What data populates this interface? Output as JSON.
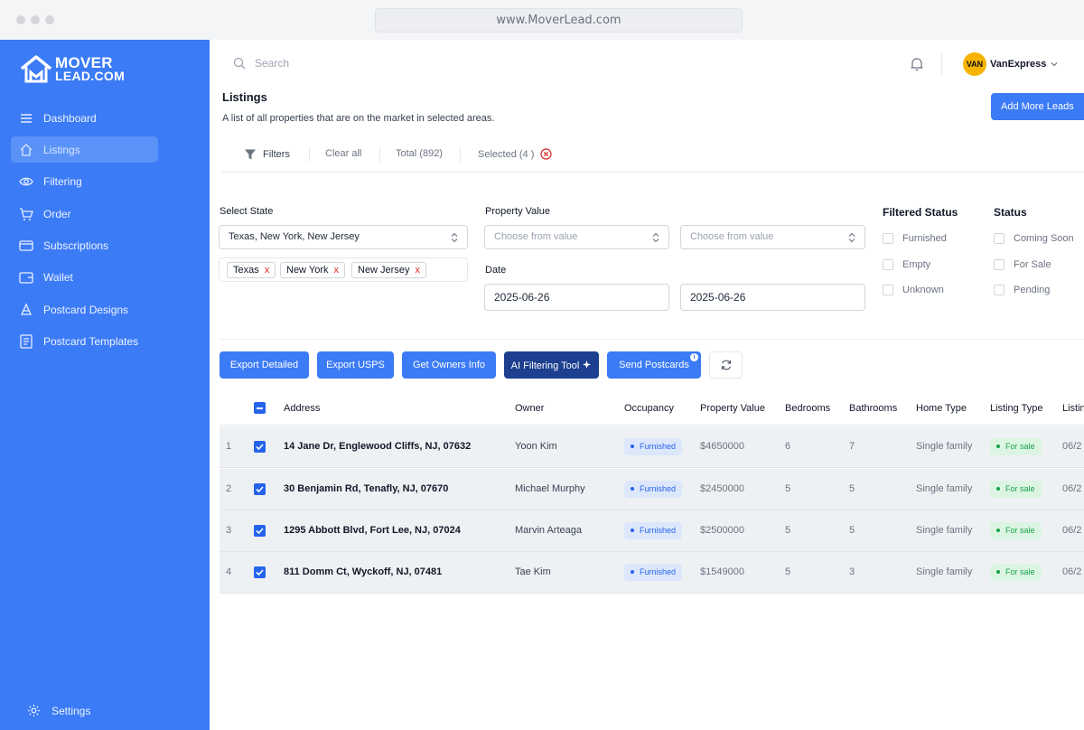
{
  "browser": {
    "url": "www.MoverLead.com"
  },
  "brand": {
    "line1": "MOVER",
    "line2": "LEAD.COM"
  },
  "sidebar": {
    "items": [
      {
        "label": "Dashboard",
        "icon": "menu-icon"
      },
      {
        "label": "Listings",
        "icon": "home-icon",
        "active": true
      },
      {
        "label": "Filtering",
        "icon": "eye-icon"
      },
      {
        "label": "Order",
        "icon": "cart-icon"
      },
      {
        "label": "Subscriptions",
        "icon": "card-icon"
      },
      {
        "label": "Wallet",
        "icon": "wallet-icon"
      },
      {
        "label": "Postcard Designs",
        "icon": "palette-icon"
      },
      {
        "label": "Postcard Templates",
        "icon": "template-icon"
      }
    ],
    "settings_label": "Settings"
  },
  "topbar": {
    "search_placeholder": "Search",
    "avatar_text": "VAN",
    "user_name": "VanExpress"
  },
  "page": {
    "title": "Listings",
    "subtitle": "A list of all properties that are on the market in selected areas.",
    "add_button": "Add More Leads"
  },
  "filterbar": {
    "filters": "Filters",
    "clear_all": "Clear all",
    "total": "Total (892)",
    "selected": "Selected (4 )"
  },
  "filters": {
    "state_label": "Select State",
    "state_value": "Texas, New York, New Jersey",
    "state_chips": [
      "Texas",
      "New York",
      "New Jersey"
    ],
    "chip_remove": "x",
    "value_label": "Property Value",
    "value_from_placeholder": "Choose from value",
    "value_to_placeholder": "Choose from value",
    "date_label": "Date",
    "date_from": "2025-06-26",
    "date_to": "2025-06-26",
    "filtered_status_label": "Filtered Status",
    "filtered_status_options": [
      "Furnished",
      "Empty",
      "Unknown"
    ],
    "status_label": "Status",
    "status_options": [
      "Coming Soon",
      "For Sale",
      "Pending"
    ]
  },
  "actions": {
    "export_detailed": "Export Detailed",
    "export_usps": "Export USPS",
    "get_owners": "Get Owners Info",
    "ai_tool": "AI Filtering Tool",
    "send_postcards": "Send Postcards",
    "send_badge": "i"
  },
  "table": {
    "columns": [
      "Address",
      "Owner",
      "Occupancy",
      "Property Value",
      "Bedrooms",
      "Bathrooms",
      "Home Type",
      "Listing Type",
      "Listin"
    ],
    "rows": [
      {
        "num": "1",
        "address": "14 Jane Dr, Englewood Cliffs, NJ, 07632",
        "owner": "Yoon Kim",
        "occupancy": "Furnished",
        "value": "$4650000",
        "bedrooms": "6",
        "bathrooms": "7",
        "home_type": "Single family",
        "listing_type": "For sale",
        "date": "06/2"
      },
      {
        "num": "2",
        "address": "30 Benjamin Rd, Tenafly, NJ, 07670",
        "owner": "Michael Murphy",
        "occupancy": "Furnished",
        "value": "$2450000",
        "bedrooms": "5",
        "bathrooms": "5",
        "home_type": "Single family",
        "listing_type": "For sale",
        "date": "06/2"
      },
      {
        "num": "3",
        "address": "1295 Abbott Blvd, Fort Lee, NJ, 07024",
        "owner": "Marvin Arteaga",
        "occupancy": "Furnished",
        "value": "$2500000",
        "bedrooms": "5",
        "bathrooms": "5",
        "home_type": "Single family",
        "listing_type": "For sale",
        "date": "06/2"
      },
      {
        "num": "4",
        "address": "811 Domm Ct, Wyckoff, NJ, 07481",
        "owner": "Tae Kim",
        "occupancy": "Furnished",
        "value": "$1549000",
        "bedrooms": "5",
        "bathrooms": "3",
        "home_type": "Single family",
        "listing_type": "For sale",
        "date": "06/2"
      }
    ]
  },
  "colors": {
    "primary": "#3b7bf6",
    "ai_button": "#1c3f8f",
    "sidebar": "#3b7bf6"
  }
}
